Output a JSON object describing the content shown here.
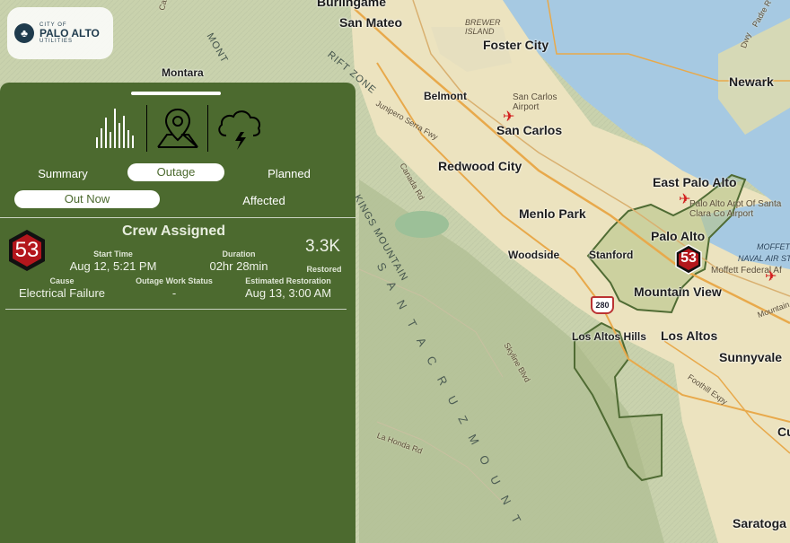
{
  "logo": {
    "city_of": "CITY OF",
    "name": "PALO ALTO",
    "sub": "UTILITIES"
  },
  "panel": {
    "icon_tabs": [
      {
        "name": "chart-bars-icon"
      },
      {
        "name": "map-pin-icon"
      },
      {
        "name": "storm-cloud-icon"
      }
    ],
    "tabs": {
      "summary": "Summary",
      "outage": "Outage",
      "planned": "Planned"
    },
    "subtabs": {
      "out_now": "Out Now",
      "affected": "Affected"
    },
    "card": {
      "badge_number": "53",
      "title": "Crew Assigned",
      "start_time_label": "Start Time",
      "start_time": "Aug 12, 5:21 PM",
      "duration_label": "Duration",
      "duration": "02hr 28min",
      "restored_value": "3.3K",
      "restored_label": "Restored",
      "cause_label": "Cause",
      "cause": "Electrical Failure",
      "work_status_label": "Outage Work Status",
      "work_status": "-",
      "est_restore_label": "Estimated Restoration",
      "est_restore": "Aug 13, 3:00 AM"
    }
  },
  "map": {
    "marker_number": "53",
    "cities": {
      "burlingame": "Burlingame",
      "san_mateo": "San Mateo",
      "foster_city": "Foster City",
      "montara": "Montara",
      "belmont": "Belmont",
      "san_carlos": "San Carlos",
      "redwood_city": "Redwood City",
      "menlo_park": "Menlo Park",
      "east_palo_alto": "East Palo Alto",
      "palo_alto": "Palo Alto",
      "stanford": "Stanford",
      "woodside": "Woodside",
      "mountain_view": "Mountain View",
      "los_altos_hills": "Los Altos Hills",
      "los_altos": "Los Altos",
      "sunnyvale": "Sunnyvale",
      "newark": "Newark",
      "saratoga": "Saratoga",
      "cu": "Cu"
    },
    "features": {
      "brewer_island": "BREWER ISLAND",
      "san_carlos_airport": "San Carlos Airport",
      "palo_alto_airport": "Palo Alto Arpt Of Santa Clara Co Airport",
      "moffett": "MOFFETT",
      "moffett_federal": "Moffett Federal Af",
      "naval_air": "NAVAL AIR STA",
      "mountain": "Mountain",
      "padre": "Padre R",
      "dwy": "Dwy",
      "santa_cruz_mount": "S A N T A   C R U Z   M O U N T",
      "kings_mountain": "KINGS MOUNTAIN",
      "mont": "MONT",
      "rift_zone": "RIFT ZONE",
      "junipero_serra": "Junipero Serra Fwy",
      "canada_rd": "Canada Rd",
      "skyline": "Skyline Blvd",
      "la_honda": "La Honda Rd",
      "foothill": "Foothill Expy",
      "interstate": "280",
      "cabrillo": "Cabrillo Hwy"
    }
  }
}
